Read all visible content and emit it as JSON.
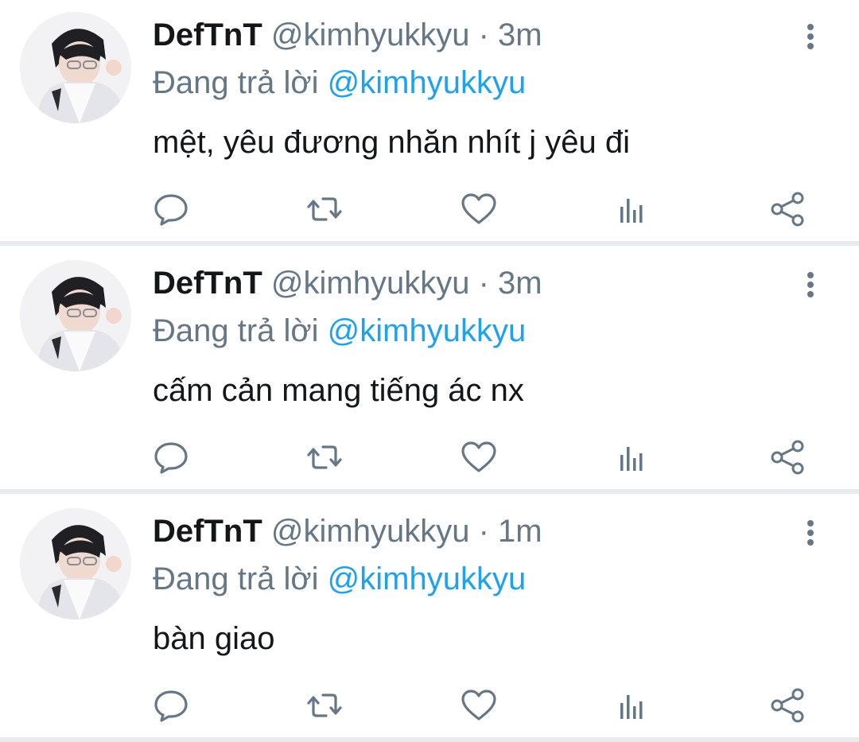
{
  "tweets": [
    {
      "display_name": "DefTnT",
      "handle": "@kimhyukkyu",
      "separator": "·",
      "time": "3m",
      "replying_prefix": "Đang trả lời",
      "replying_to": "@kimhyukkyu",
      "text": "mệt, yêu đương nhăn nhít j yêu đi"
    },
    {
      "display_name": "DefTnT",
      "handle": "@kimhyukkyu",
      "separator": "·",
      "time": "3m",
      "replying_prefix": "Đang trả lời",
      "replying_to": "@kimhyukkyu",
      "text": "cấm cản mang tiếng ác nx"
    },
    {
      "display_name": "DefTnT",
      "handle": "@kimhyukkyu",
      "separator": "·",
      "time": "1m",
      "replying_prefix": "Đang trả lời",
      "replying_to": "@kimhyukkyu",
      "text": "bàn giao"
    }
  ],
  "icons": {
    "reply": "reply-icon",
    "retweet": "retweet-icon",
    "like": "like-icon",
    "stats": "stats-icon",
    "share": "share-icon",
    "more": "more-vertical-icon"
  },
  "colors": {
    "text": "#14171a",
    "muted": "#657786",
    "link": "#1da1f2",
    "divider": "#e9ecef",
    "icon": "#657786"
  }
}
